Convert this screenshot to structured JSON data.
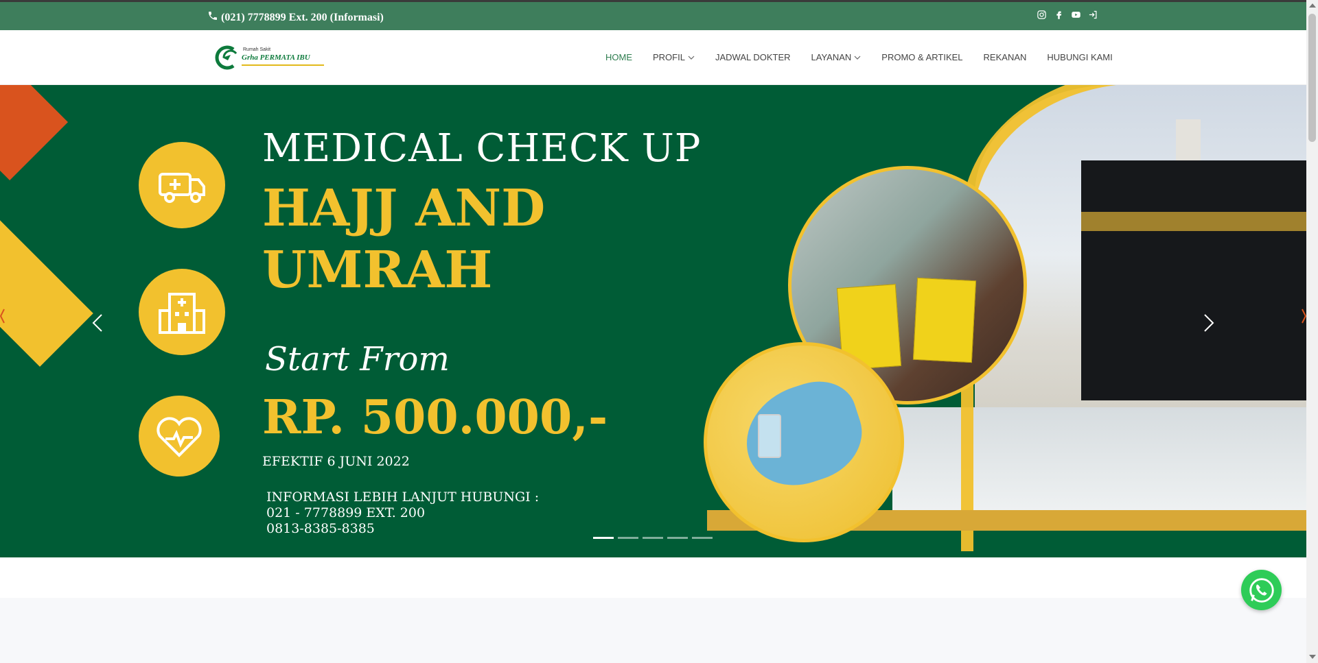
{
  "topbar": {
    "phone_text": "(021) 7778899 Ext. 200 (Informasi)",
    "social_icons": [
      "instagram-icon",
      "facebook-icon",
      "youtube-icon",
      "login-icon"
    ]
  },
  "logo": {
    "small_text": "Rumah Sakit",
    "name": "Grha PERMATA IBU"
  },
  "nav": {
    "items": [
      {
        "label": "HOME",
        "active": true,
        "dropdown": false
      },
      {
        "label": "PROFIL",
        "active": false,
        "dropdown": true
      },
      {
        "label": "JADWAL DOKTER",
        "active": false,
        "dropdown": false
      },
      {
        "label": "LAYANAN",
        "active": false,
        "dropdown": true
      },
      {
        "label": "PROMO & ARTIKEL",
        "active": false,
        "dropdown": false
      },
      {
        "label": "REKANAN",
        "active": false,
        "dropdown": false
      },
      {
        "label": "HUBUNGI KAMI",
        "active": false,
        "dropdown": false
      }
    ]
  },
  "slide": {
    "title_line1": "MEDICAL CHECK UP",
    "title_line2": "HAJJ AND",
    "title_line3": "UMRAH",
    "start_from": "Start From",
    "price": "RP. 500.000,-",
    "effective": "EFEKTIF 6 JUNI 2022",
    "info_line1": "INFORMASI LEBIH LANJUT HUBUNGI :",
    "info_line2": "021 - 7778899 EXT. 200",
    "info_line3": "0813-8385-8385",
    "feature_icons": [
      "ambulance-icon",
      "hospital-icon",
      "heart-pulse-icon"
    ]
  },
  "carousel": {
    "slide_count": 5,
    "active_index": 0
  },
  "colors": {
    "topbar": "#3e7e5c",
    "slide_bg": "#005c36",
    "accent_yellow": "#f2c12e",
    "nav_active": "#2e7d4f",
    "whatsapp": "#2ecc58"
  }
}
